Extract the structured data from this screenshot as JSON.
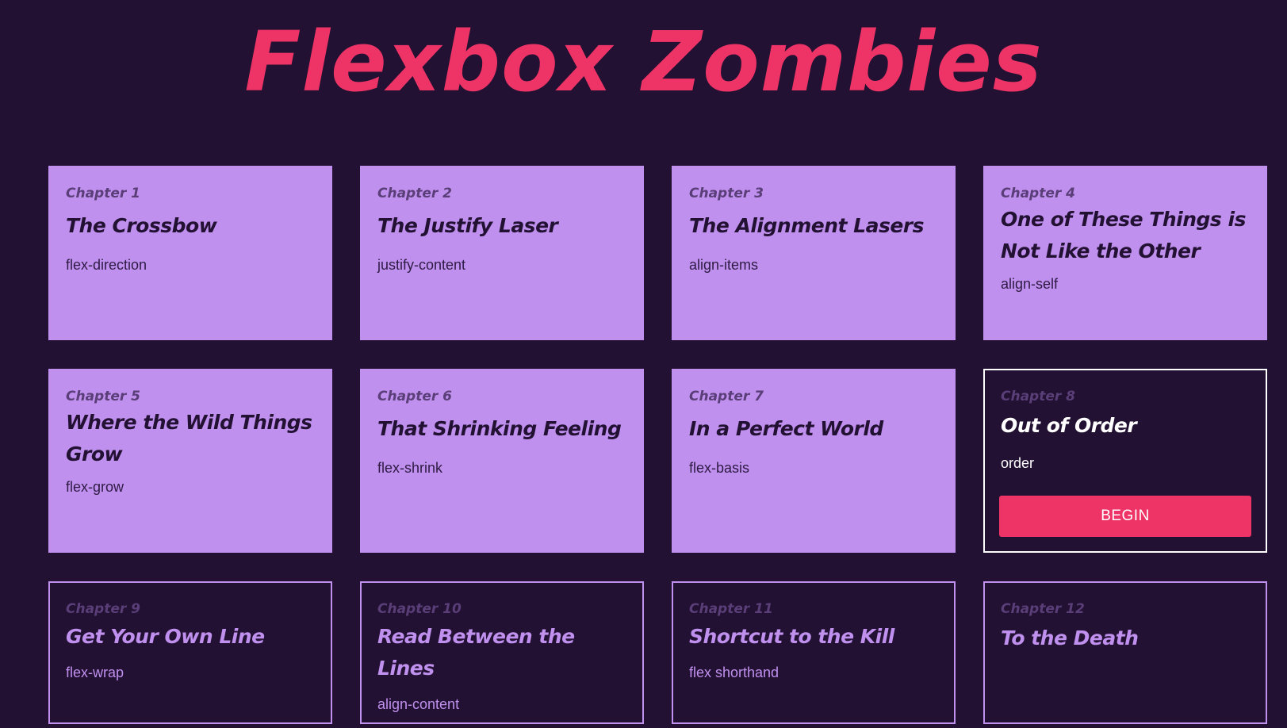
{
  "site": {
    "title": "Flexbox Zombies"
  },
  "chapters": [
    {
      "label": "Chapter 1",
      "title": "The Crossbow",
      "property": "flex-direction",
      "status": "completed"
    },
    {
      "label": "Chapter 2",
      "title": "The Justify Laser",
      "property": "justify-content",
      "status": "completed"
    },
    {
      "label": "Chapter 3",
      "title": "The Alignment Lasers",
      "property": "align-items",
      "status": "completed"
    },
    {
      "label": "Chapter 4",
      "title": "One of These Things is Not Like the Other",
      "property": "align-self",
      "status": "completed"
    },
    {
      "label": "Chapter 5",
      "title": "Where the Wild Things Grow",
      "property": "flex-grow",
      "status": "completed"
    },
    {
      "label": "Chapter 6",
      "title": "That Shrinking Feeling",
      "property": "flex-shrink",
      "status": "completed"
    },
    {
      "label": "Chapter 7",
      "title": "In a Perfect World",
      "property": "flex-basis",
      "status": "completed"
    },
    {
      "label": "Chapter 8",
      "title": "Out of Order",
      "property": "order",
      "status": "current",
      "button_label": "BEGIN"
    },
    {
      "label": "Chapter 9",
      "title": "Get Your Own Line",
      "property": "flex-wrap",
      "status": "locked"
    },
    {
      "label": "Chapter 10",
      "title": "Read Between the Lines",
      "property": "align-content",
      "status": "locked"
    },
    {
      "label": "Chapter 11",
      "title": "Shortcut to the Kill",
      "property": "flex shorthand",
      "status": "locked"
    },
    {
      "label": "Chapter 12",
      "title": "To the Death",
      "property": "",
      "status": "locked"
    }
  ],
  "colors": {
    "background": "#221133",
    "accent": "#ee3366",
    "card_completed": "#c090ee",
    "card_current_border": "#ffffff",
    "card_locked_border": "#c090ee"
  }
}
